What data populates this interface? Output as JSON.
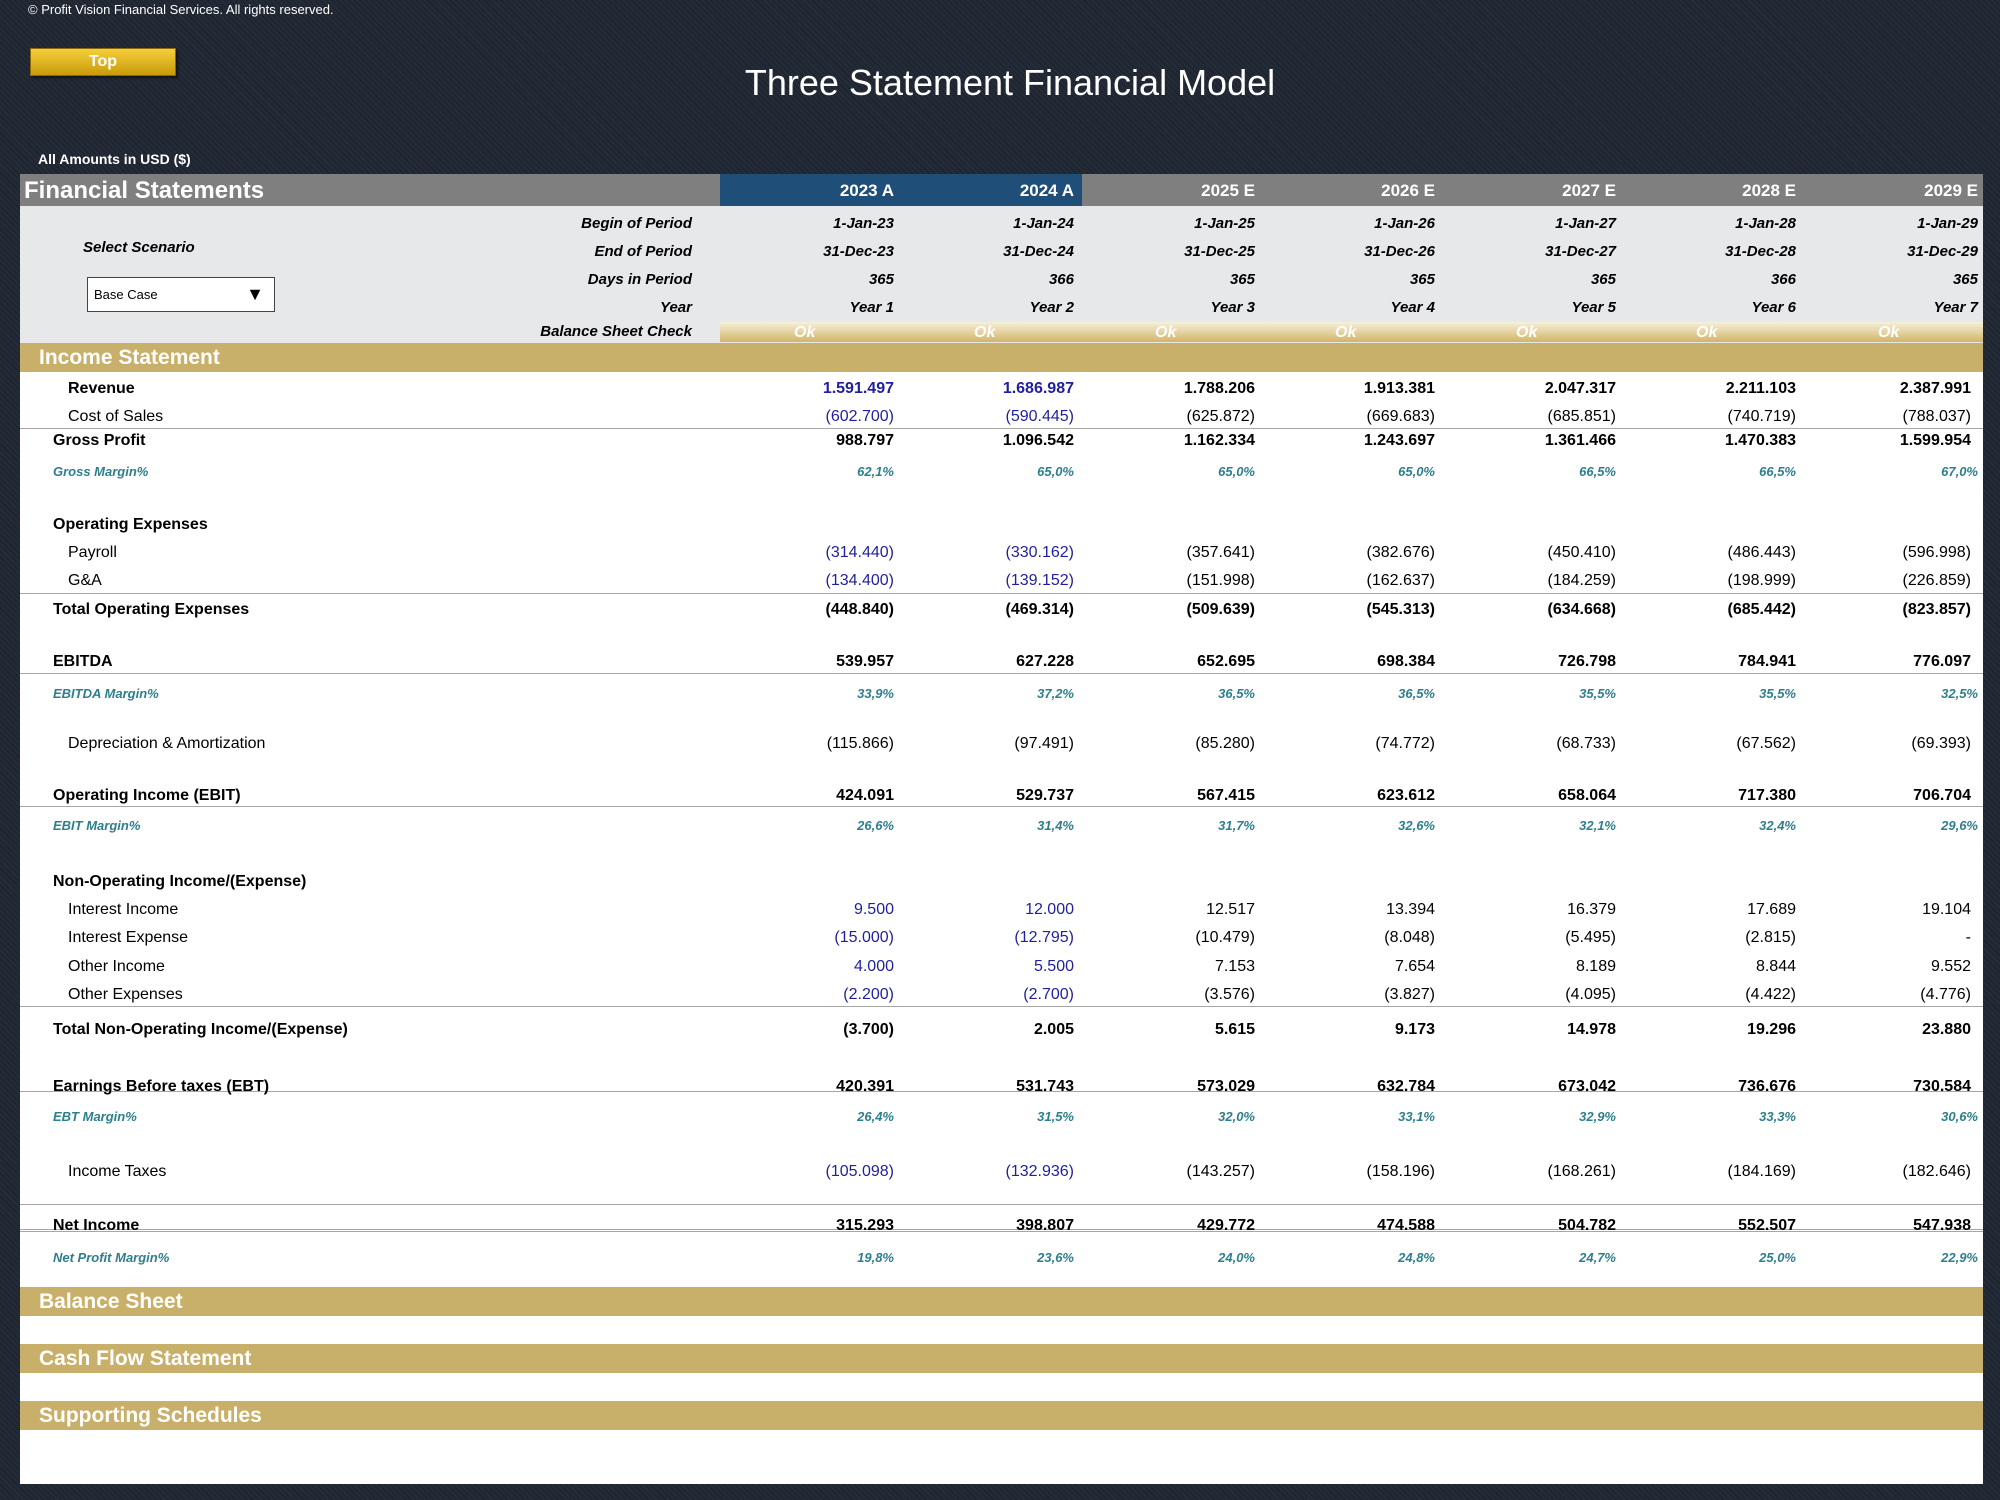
{
  "copyright": "© Profit Vision Financial Services. All rights reserved.",
  "top_button": "Top",
  "title": "Three Statement Financial Model",
  "amounts_note": "All Amounts in  USD ($)",
  "header": {
    "label": "Financial Statements",
    "columns": [
      "2023 A",
      "2024 A",
      "2025 E",
      "2026 E",
      "2027 E",
      "2028 E",
      "2029 E"
    ]
  },
  "scenario": {
    "label": "Select Scenario",
    "value": "Base Case"
  },
  "info_rows": [
    {
      "label": "Begin of Period",
      "values": [
        "1-Jan-23",
        "1-Jan-24",
        "1-Jan-25",
        "1-Jan-26",
        "1-Jan-27",
        "1-Jan-28",
        "1-Jan-29"
      ]
    },
    {
      "label": "End of Period",
      "values": [
        "31-Dec-23",
        "31-Dec-24",
        "31-Dec-25",
        "31-Dec-26",
        "31-Dec-27",
        "31-Dec-28",
        "31-Dec-29"
      ]
    },
    {
      "label": "Days in Period",
      "values": [
        "365",
        "366",
        "365",
        "365",
        "365",
        "366",
        "365"
      ]
    },
    {
      "label": "Year",
      "values": [
        "Year 1",
        "Year 2",
        "Year 3",
        "Year 4",
        "Year 5",
        "Year 6",
        "Year 7"
      ]
    }
  ],
  "balance_check": {
    "label": "Balance Sheet Check",
    "values": [
      "Ok",
      "Ok",
      "Ok",
      "Ok",
      "Ok",
      "Ok",
      "Ok"
    ]
  },
  "sections": {
    "income_statement": "Income Statement",
    "balance_sheet": "Balance Sheet",
    "cash_flow": "Cash Flow Statement",
    "supporting": "Supporting Schedules"
  },
  "rows": [
    {
      "label": "Revenue",
      "style": "bold",
      "values": [
        "1.591.497",
        "1.686.987",
        "1.788.206",
        "1.913.381",
        "2.047.317",
        "2.211.103",
        "2.387.991"
      ]
    },
    {
      "label": "Cost of Sales",
      "style": "normal",
      "values": [
        "(602.700)",
        "(590.445)",
        "(625.872)",
        "(669.683)",
        "(685.851)",
        "(740.719)",
        "(788.037)"
      ]
    },
    {
      "label": "Gross Profit",
      "style": "bold",
      "values": [
        "988.797",
        "1.096.542",
        "1.162.334",
        "1.243.697",
        "1.361.466",
        "1.470.383",
        "1.599.954"
      ]
    },
    {
      "label": "Gross Margin%",
      "style": "margin",
      "values": [
        "62,1%",
        "65,0%",
        "65,0%",
        "65,0%",
        "66,5%",
        "66,5%",
        "67,0%"
      ]
    },
    {
      "label": "Operating Expenses",
      "style": "bold",
      "values": [
        "",
        "",
        "",
        "",
        "",
        "",
        ""
      ]
    },
    {
      "label": "Payroll",
      "style": "normal",
      "values": [
        "(314.440)",
        "(330.162)",
        "(357.641)",
        "(382.676)",
        "(450.410)",
        "(486.443)",
        "(596.998)"
      ]
    },
    {
      "label": "G&A",
      "style": "normal",
      "values": [
        "(134.400)",
        "(139.152)",
        "(151.998)",
        "(162.637)",
        "(184.259)",
        "(198.999)",
        "(226.859)"
      ]
    },
    {
      "label": "Total Operating Expenses",
      "style": "bold",
      "values": [
        "(448.840)",
        "(469.314)",
        "(509.639)",
        "(545.313)",
        "(634.668)",
        "(685.442)",
        "(823.857)"
      ]
    },
    {
      "label": "EBITDA",
      "style": "bold",
      "values": [
        "539.957",
        "627.228",
        "652.695",
        "698.384",
        "726.798",
        "784.941",
        "776.097"
      ]
    },
    {
      "label": "EBITDA Margin%",
      "style": "margin",
      "values": [
        "33,9%",
        "37,2%",
        "36,5%",
        "36,5%",
        "35,5%",
        "35,5%",
        "32,5%"
      ]
    },
    {
      "label": "Depreciation & Amortization",
      "style": "normal",
      "values": [
        "(115.866)",
        "(97.491)",
        "(85.280)",
        "(74.772)",
        "(68.733)",
        "(67.562)",
        "(69.393)"
      ]
    },
    {
      "label": "Operating Income (EBIT)",
      "style": "bold",
      "values": [
        "424.091",
        "529.737",
        "567.415",
        "623.612",
        "658.064",
        "717.380",
        "706.704"
      ]
    },
    {
      "label": "EBIT Margin%",
      "style": "margin",
      "values": [
        "26,6%",
        "31,4%",
        "31,7%",
        "32,6%",
        "32,1%",
        "32,4%",
        "29,6%"
      ]
    },
    {
      "label": "Non-Operating Income/(Expense)",
      "style": "bold",
      "values": [
        "",
        "",
        "",
        "",
        "",
        "",
        ""
      ]
    },
    {
      "label": "Interest Income",
      "style": "normal",
      "values": [
        "9.500",
        "12.000",
        "12.517",
        "13.394",
        "16.379",
        "17.689",
        "19.104"
      ]
    },
    {
      "label": "Interest Expense",
      "style": "normal",
      "values": [
        "(15.000)",
        "(12.795)",
        "(10.479)",
        "(8.048)",
        "(5.495)",
        "(2.815)",
        "-"
      ]
    },
    {
      "label": "Other Income",
      "style": "normal",
      "values": [
        "4.000",
        "5.500",
        "7.153",
        "7.654",
        "8.189",
        "8.844",
        "9.552"
      ]
    },
    {
      "label": "Other Expenses",
      "style": "normal",
      "values": [
        "(2.200)",
        "(2.700)",
        "(3.576)",
        "(3.827)",
        "(4.095)",
        "(4.422)",
        "(4.776)"
      ]
    },
    {
      "label": "Total Non-Operating Income/(Expense)",
      "style": "bold",
      "values": [
        "(3.700)",
        "2.005",
        "5.615",
        "9.173",
        "14.978",
        "19.296",
        "23.880"
      ]
    },
    {
      "label": "Earnings Before taxes (EBT)",
      "style": "bold",
      "values": [
        "420.391",
        "531.743",
        "573.029",
        "632.784",
        "673.042",
        "736.676",
        "730.584"
      ]
    },
    {
      "label": "EBT Margin%",
      "style": "margin",
      "values": [
        "26,4%",
        "31,5%",
        "32,0%",
        "33,1%",
        "32,9%",
        "33,3%",
        "30,6%"
      ]
    },
    {
      "label": "Income Taxes",
      "style": "normal",
      "values": [
        "(105.098)",
        "(132.936)",
        "(143.257)",
        "(158.196)",
        "(168.261)",
        "(184.169)",
        "(182.646)"
      ]
    },
    {
      "label": "Net Income",
      "style": "bold",
      "values": [
        "315.293",
        "398.807",
        "429.772",
        "474.588",
        "504.782",
        "552.507",
        "547.938"
      ]
    },
    {
      "label": "Net Profit Margin%",
      "style": "margin",
      "values": [
        "19,8%",
        "23,6%",
        "24,0%",
        "24,8%",
        "24,7%",
        "25,0%",
        "22,9%"
      ]
    }
  ]
}
